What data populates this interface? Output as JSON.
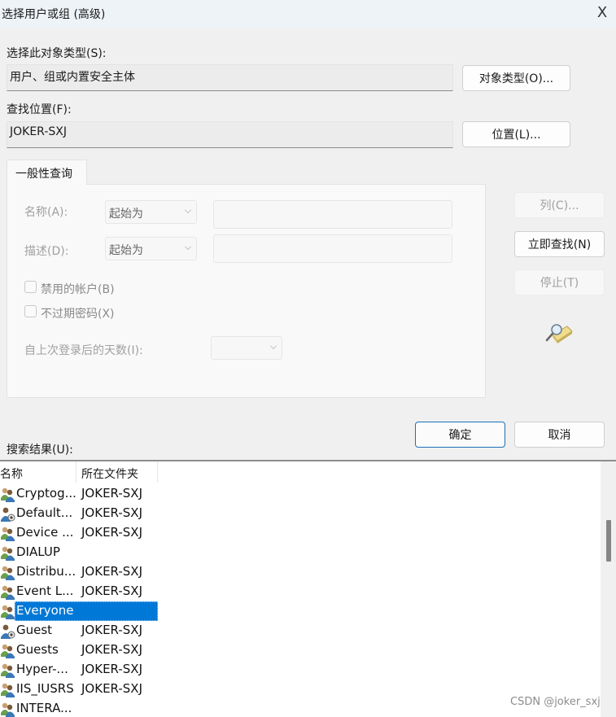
{
  "window": {
    "title": "选择用户或组 (高级)",
    "close_label": "X"
  },
  "object_type": {
    "label": "选择此对象类型(S):",
    "value": "用户、组或内置安全主体",
    "button": "对象类型(O)..."
  },
  "location": {
    "label": "查找位置(F):",
    "value": "JOKER-SXJ",
    "button": "位置(L)..."
  },
  "query": {
    "tab_label": "一般性查询",
    "name_label": "名称(A):",
    "name_mode": "起始为",
    "name_value": "",
    "desc_label": "描述(D):",
    "desc_mode": "起始为",
    "desc_value": "",
    "disabled_accounts_label": "禁用的帐户(B)",
    "disabled_accounts_checked": false,
    "non_expiring_label": "不过期密码(X)",
    "non_expiring_checked": false,
    "days_label": "自上次登录后的天数(I):",
    "days_value": ""
  },
  "side_buttons": {
    "columns": "列(C)...",
    "find_now": "立即查找(N)",
    "stop": "停止(T)"
  },
  "dialog_buttons": {
    "ok": "确定",
    "cancel": "取消"
  },
  "results": {
    "label": "搜索结果(U):",
    "columns": [
      "名称",
      "所在文件夹"
    ],
    "rows": [
      {
        "name": "Cryptog...",
        "folder": "JOKER-SXJ",
        "icon": "group-icon",
        "selected": false
      },
      {
        "name": "Default...",
        "folder": "JOKER-SXJ",
        "icon": "user-icon",
        "selected": false
      },
      {
        "name": "Device ...",
        "folder": "JOKER-SXJ",
        "icon": "group-icon",
        "selected": false
      },
      {
        "name": "DIALUP",
        "folder": "",
        "icon": "group-icon",
        "selected": false
      },
      {
        "name": "Distribu...",
        "folder": "JOKER-SXJ",
        "icon": "group-icon",
        "selected": false
      },
      {
        "name": "Event L...",
        "folder": "JOKER-SXJ",
        "icon": "group-icon",
        "selected": false
      },
      {
        "name": "Everyone",
        "folder": "",
        "icon": "group-icon",
        "selected": true
      },
      {
        "name": "Guest",
        "folder": "JOKER-SXJ",
        "icon": "user-icon",
        "selected": false
      },
      {
        "name": "Guests",
        "folder": "JOKER-SXJ",
        "icon": "group-icon",
        "selected": false
      },
      {
        "name": "Hyper-...",
        "folder": "JOKER-SXJ",
        "icon": "group-icon",
        "selected": false
      },
      {
        "name": "IIS_IUSRS",
        "folder": "JOKER-SXJ",
        "icon": "group-icon",
        "selected": false
      },
      {
        "name": "INTERA...",
        "folder": "",
        "icon": "group-icon",
        "selected": false
      }
    ]
  },
  "watermark": "CSDN @joker_sxj"
}
